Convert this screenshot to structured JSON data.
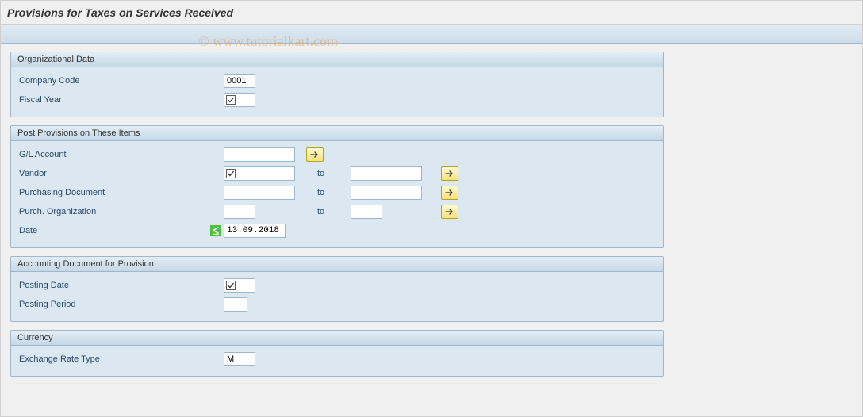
{
  "title": "Provisions for Taxes on Services Received",
  "watermark": "© www.tutorialkart.com",
  "sections": {
    "org": {
      "header": "Organizational Data",
      "company_code_label": "Company Code",
      "company_code_value": "0001",
      "fiscal_year_label": "Fiscal Year"
    },
    "items": {
      "header": "Post Provisions on These Items",
      "gl_label": "G/L Account",
      "vendor_label": "Vendor",
      "purdoc_label": "Purchasing Document",
      "porg_label": "Purch. Organization",
      "date_label": "Date",
      "date_value": "13.09.2018",
      "to_label": "to"
    },
    "acct": {
      "header": "Accounting Document for Provision",
      "posting_date_label": "Posting Date",
      "posting_period_label": "Posting Period"
    },
    "currency": {
      "header": "Currency",
      "exrate_label": "Exchange Rate Type",
      "exrate_value": "M"
    }
  }
}
